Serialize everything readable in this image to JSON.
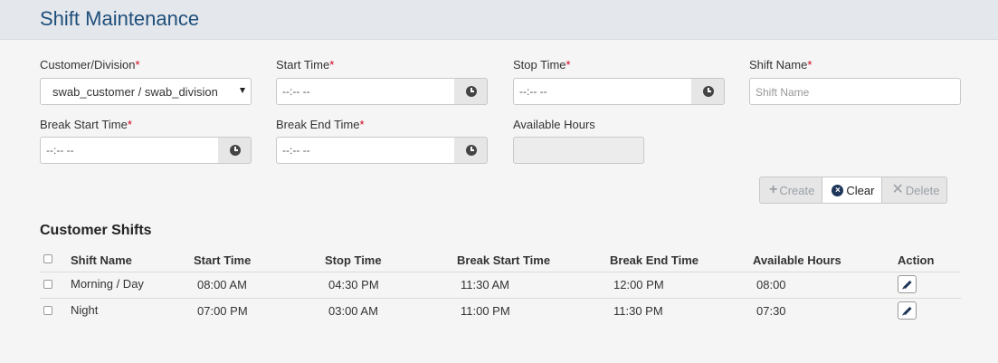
{
  "header": {
    "title": "Shift Maintenance"
  },
  "form": {
    "customer_label": "Customer/Division",
    "customer_value": "swab_customer / swab_division",
    "start_time_label": "Start Time",
    "start_time_value": "--:-- --",
    "stop_time_label": "Stop Time",
    "stop_time_value": "--:-- --",
    "shift_name_label": "Shift Name",
    "shift_name_placeholder": "Shift Name",
    "break_start_label": "Break Start Time",
    "break_start_value": "--:-- --",
    "break_end_label": "Break End Time",
    "break_end_value": "--:-- --",
    "available_hours_label": "Available Hours",
    "required_marker": "*"
  },
  "actions": {
    "create_label": "Create",
    "clear_label": "Clear",
    "delete_label": "Delete"
  },
  "table": {
    "title": "Customer Shifts",
    "columns": [
      "Shift Name",
      "Start Time",
      "Stop Time",
      "Break Start Time",
      "Break End Time",
      "Available Hours",
      "Action"
    ],
    "rows": [
      [
        "Morning / Day",
        "08:00 AM",
        "04:30 PM",
        "11:30 AM",
        "12:00 PM",
        "08:00"
      ],
      [
        "Night",
        "07:00 PM",
        "03:00 AM",
        "11:00 PM",
        "11:30 PM",
        "07:30"
      ]
    ]
  },
  "icons": {
    "clock": "clock-icon",
    "plus": "plus-icon",
    "clear": "clear-circle-icon",
    "delete": "x-icon",
    "edit": "pencil-icon"
  },
  "colors": {
    "title": "#1f4f7b",
    "required": "#d0021b",
    "icon_dark": "#1d3557"
  }
}
